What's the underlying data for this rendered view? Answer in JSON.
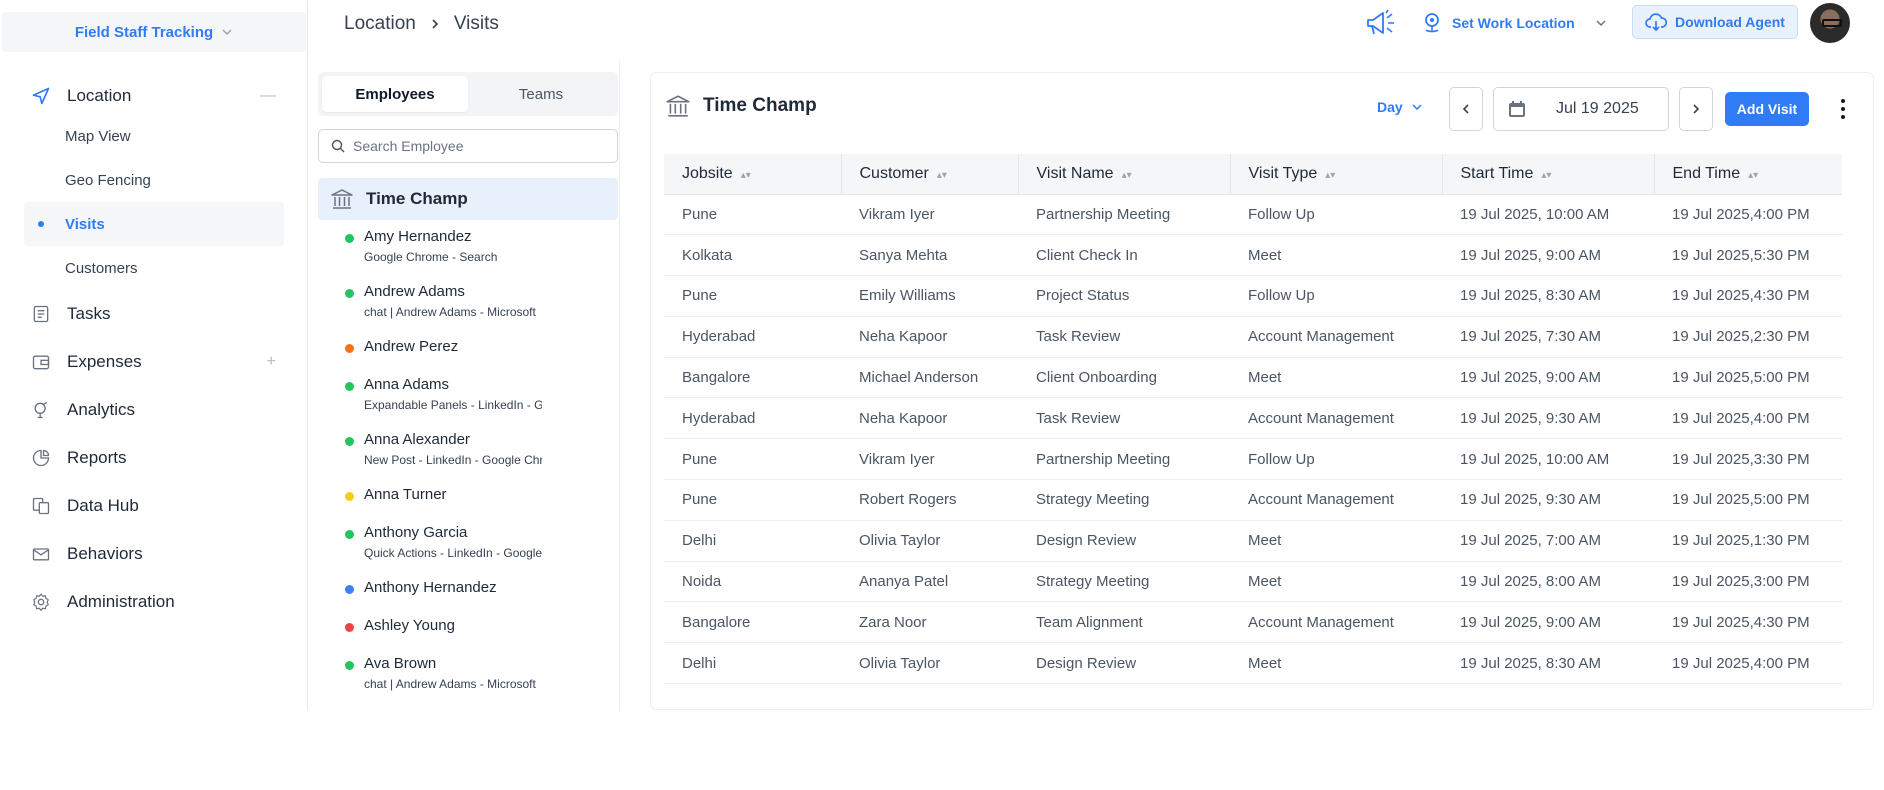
{
  "sidebar": {
    "workspace": "Field Staff Tracking",
    "nav": {
      "location": "Location",
      "map_view": "Map View",
      "geo_fencing": "Geo Fencing",
      "visits": "Visits",
      "customers": "Customers",
      "tasks": "Tasks",
      "expenses": "Expenses",
      "analytics": "Analytics",
      "reports": "Reports",
      "data_hub": "Data Hub",
      "behaviors": "Behaviors",
      "administration": "Administration"
    },
    "collapse_symbol": "—",
    "expand_symbol": "+"
  },
  "header": {
    "breadcrumb": [
      "Location",
      "Visits"
    ],
    "work_location": "Set Work Location",
    "download": "Download Agent"
  },
  "employees_panel": {
    "tabs": [
      "Employees",
      "Teams"
    ],
    "search_placeholder": "Search Employee",
    "team_name": "Time Champ",
    "employees": [
      {
        "name": "Amy Hernandez",
        "activity": "Google Chrome - Search",
        "status_color": "#22c55e"
      },
      {
        "name": "Andrew Adams",
        "activity": "chat | Andrew Adams - Microsoft",
        "status_color": "#22c55e"
      },
      {
        "name": "Andrew Perez",
        "activity": "",
        "status_color": "#f97316"
      },
      {
        "name": "Anna Adams",
        "activity": "Expandable Panels - LinkedIn - Google",
        "status_color": "#22c55e"
      },
      {
        "name": "Anna Alexander",
        "activity": "New Post - LinkedIn - Google Chrome",
        "status_color": "#22c55e"
      },
      {
        "name": "Anna Turner",
        "activity": "",
        "status_color": "#facc15"
      },
      {
        "name": "Anthony Garcia",
        "activity": "Quick Actions - LinkedIn - Google",
        "status_color": "#22c55e"
      },
      {
        "name": "Anthony Hernandez",
        "activity": "",
        "status_color": "#3b82f6"
      },
      {
        "name": "Ashley Young",
        "activity": "",
        "status_color": "#ef4444"
      },
      {
        "name": "Ava Brown",
        "activity": "chat | Andrew Adams - Microsoft",
        "status_color": "#22c55e"
      }
    ]
  },
  "main": {
    "title": "Time Champ",
    "period": "Day",
    "date": "Jul 19 2025",
    "add_visit": "Add Visit",
    "table": {
      "columns": [
        "Jobsite",
        "Customer",
        "Visit Name",
        "Visit Type",
        "Start Time",
        "End Time"
      ],
      "rows": [
        [
          "Pune",
          "Vikram Iyer",
          "Partnership Meeting",
          "Follow Up",
          "19 Jul 2025, 10:00 AM",
          "19 Jul 2025,4:00 PM"
        ],
        [
          "Kolkata",
          "Sanya Mehta",
          "Client Check In",
          "Meet",
          "19 Jul 2025, 9:00 AM",
          "19 Jul 2025,5:30 PM"
        ],
        [
          "Pune",
          "Emily Williams",
          "Project Status",
          "Follow Up",
          "19 Jul 2025, 8:30 AM",
          "19 Jul 2025,4:30 PM"
        ],
        [
          "Hyderabad",
          "Neha Kapoor",
          "Task Review",
          "Account Management",
          "19 Jul 2025, 7:30 AM",
          "19 Jul 2025,2:30 PM"
        ],
        [
          "Bangalore",
          "Michael Anderson",
          "Client Onboarding",
          "Meet",
          "19 Jul 2025, 9:00 AM",
          "19 Jul 2025,5:00 PM"
        ],
        [
          "Hyderabad",
          "Neha Kapoor",
          "Task Review",
          "Account Management",
          "19 Jul 2025, 9:30 AM",
          "19 Jul 2025,4:00 PM"
        ],
        [
          "Pune",
          "Vikram Iyer",
          "Partnership Meeting",
          "Follow Up",
          "19 Jul 2025, 10:00 AM",
          "19 Jul 2025,3:30 PM"
        ],
        [
          "Pune",
          "Robert Rogers",
          "Strategy Meeting",
          "Account Management",
          "19 Jul 2025, 9:30 AM",
          "19 Jul 2025,5:00 PM"
        ],
        [
          "Delhi",
          "Olivia Taylor",
          "Design Review",
          "Meet",
          "19 Jul 2025, 7:00 AM",
          "19 Jul 2025,1:30 PM"
        ],
        [
          "Noida",
          "Ananya Patel",
          "Strategy Meeting",
          "Meet",
          "19 Jul 2025, 8:00 AM",
          "19 Jul 2025,3:00 PM"
        ],
        [
          "Bangalore",
          "Zara Noor",
          "Team Alignment",
          "Account Management",
          "19 Jul 2025, 9:00 AM",
          "19 Jul 2025,4:30 PM"
        ],
        [
          "Delhi",
          "Olivia Taylor",
          "Design Review",
          "Meet",
          "19 Jul 2025, 8:30 AM",
          "19 Jul 2025,4:00 PM"
        ]
      ]
    }
  },
  "colors": {
    "accent": "#2f7cf6",
    "active_bg": "#e8f0fc",
    "header_bg": "#f5f6f8"
  },
  "icons": {
    "location": "navigation-arrow-icon",
    "tasks": "tasks-icon",
    "expenses": "wallet-icon",
    "analytics": "analytics-icon",
    "reports": "pie-chart-icon",
    "data_hub": "database-icon",
    "behaviors": "envelope-icon",
    "administration": "gear-icon"
  }
}
